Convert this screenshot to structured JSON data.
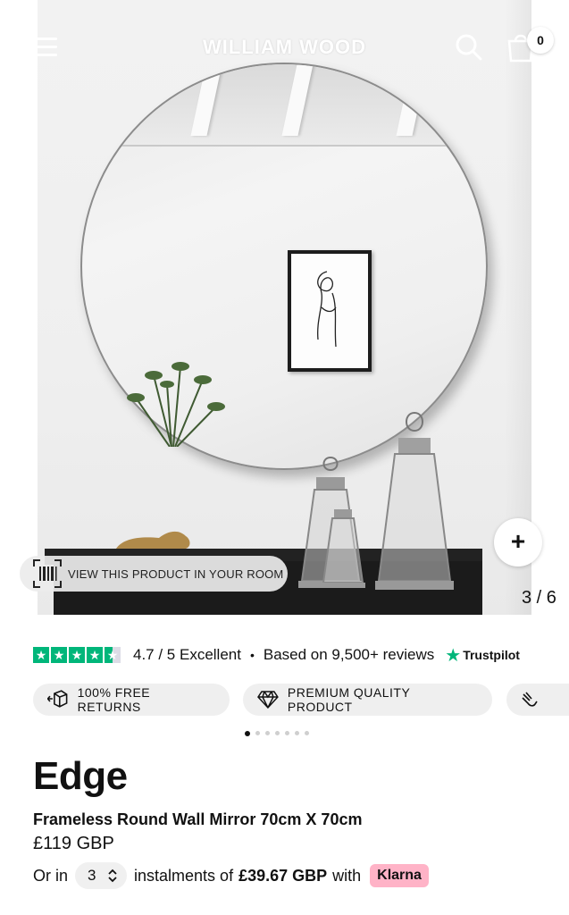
{
  "header": {
    "brand": "WILLIAM WOOD",
    "cart_count": "0",
    "menu_icon": "hamburger-menu-icon",
    "search_icon": "search-icon",
    "cart_icon": "shopping-bag-icon"
  },
  "gallery": {
    "ar_label": "VIEW THIS PRODUCT IN YOUR ROOM",
    "zoom_symbol": "+",
    "counter": "3 / 6"
  },
  "trustpilot": {
    "rating_text": "4.7 / 5 Excellent",
    "separator": "•",
    "reviews_text": "Based on 9,500+ reviews",
    "brand": "Trustpilot",
    "stars": 4.5,
    "star_color": "#00b67a"
  },
  "badges": [
    {
      "label": "100% FREE RETURNS",
      "icon": "return-box-icon"
    },
    {
      "label": "PREMIUM QUALITY PRODUCT",
      "icon": "diamond-icon"
    },
    {
      "label": "",
      "icon": "hand-icon"
    }
  ],
  "carousel": {
    "total_dots": 7,
    "active_index": 0
  },
  "product": {
    "title": "Edge",
    "subtitle": "Frameless Round Wall Mirror 70cm X 70cm",
    "price": "£119 GBP",
    "instalments_prefix": "Or in",
    "instalments_count": "3",
    "instalments_middle": "instalments of",
    "instalments_amount": "£39.67 GBP",
    "instalments_with": "with",
    "klarna_label": "Klarna",
    "klarna_color": "#ffb3c7"
  }
}
